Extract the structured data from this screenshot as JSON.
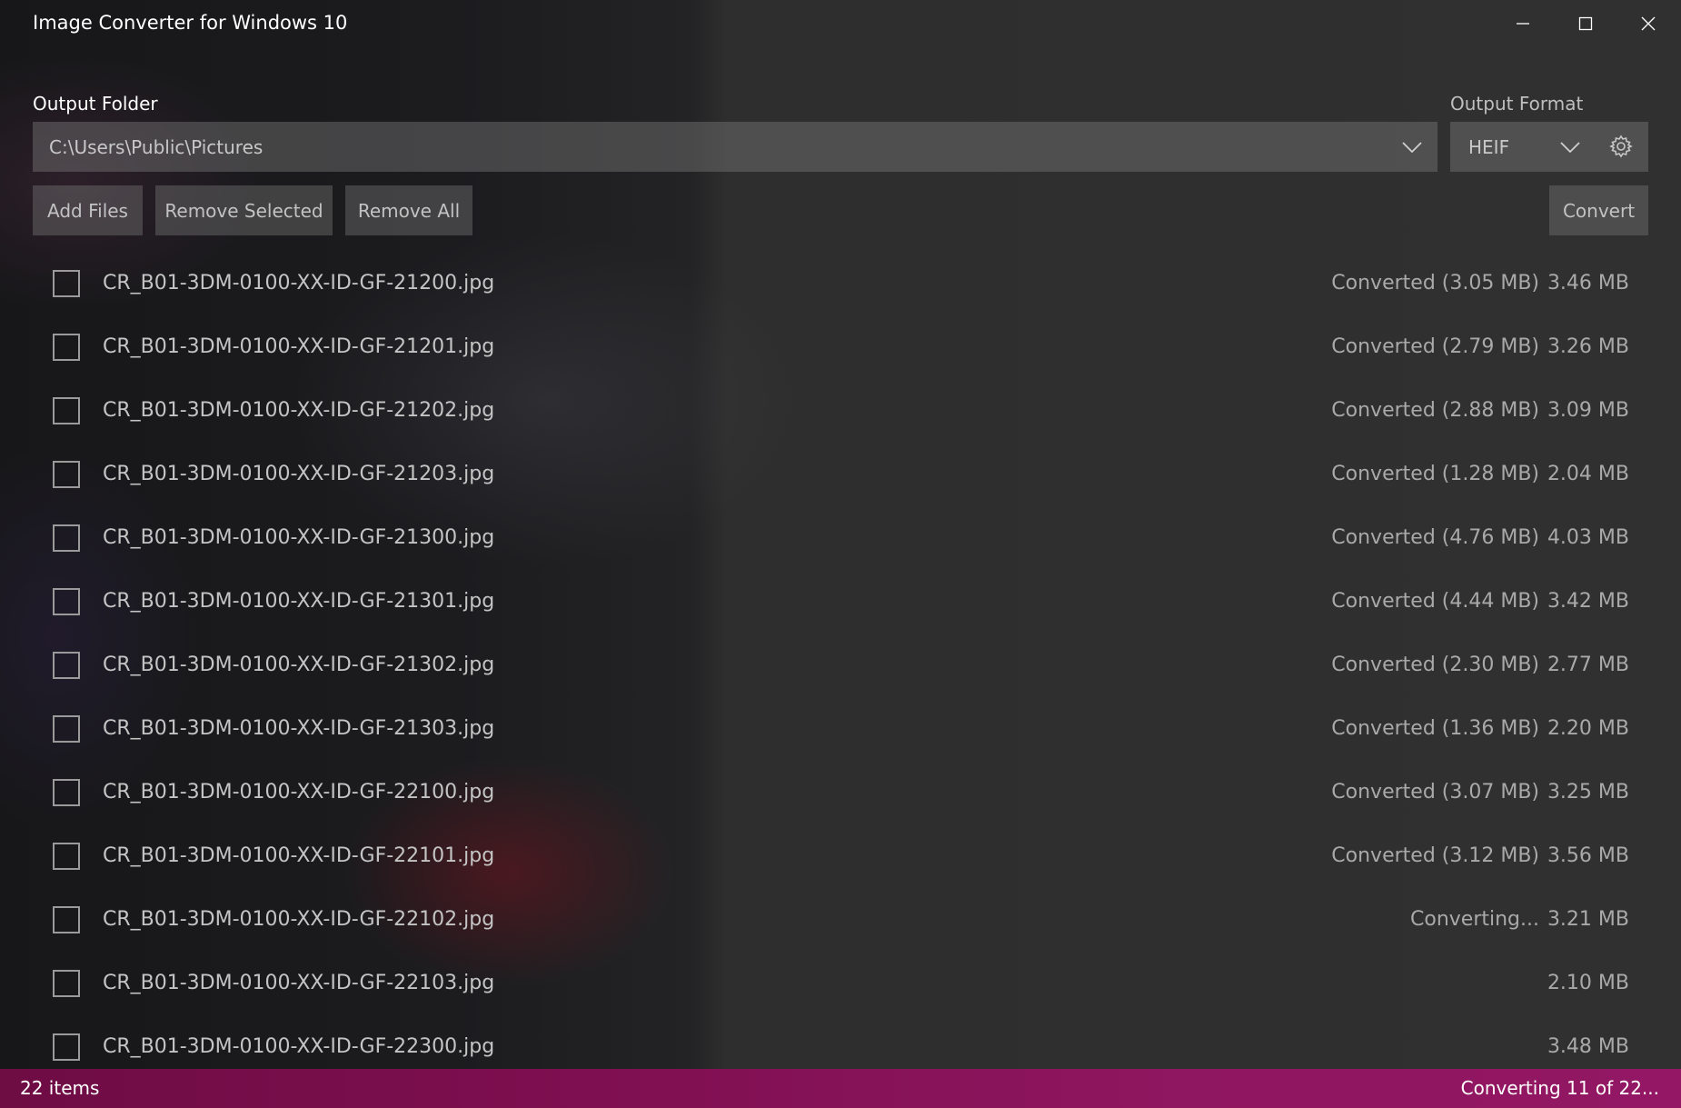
{
  "window": {
    "title": "Image Converter for Windows 10"
  },
  "output_folder": {
    "label": "Output Folder",
    "value": "C:\\Users\\Public\\Pictures"
  },
  "output_format": {
    "label": "Output Format",
    "value": "HEIF"
  },
  "toolbar": {
    "add_files": "Add Files",
    "remove_selected": "Remove Selected",
    "remove_all": "Remove All",
    "convert": "Convert"
  },
  "files": [
    {
      "name": "CR_B01-3DM-0100-XX-ID-GF-21200.jpg",
      "status": "Converted (3.05 MB)",
      "size": "3.46 MB"
    },
    {
      "name": "CR_B01-3DM-0100-XX-ID-GF-21201.jpg",
      "status": "Converted (2.79 MB)",
      "size": "3.26 MB"
    },
    {
      "name": "CR_B01-3DM-0100-XX-ID-GF-21202.jpg",
      "status": "Converted (2.88 MB)",
      "size": "3.09 MB"
    },
    {
      "name": "CR_B01-3DM-0100-XX-ID-GF-21203.jpg",
      "status": "Converted (1.28 MB)",
      "size": "2.04 MB"
    },
    {
      "name": "CR_B01-3DM-0100-XX-ID-GF-21300.jpg",
      "status": "Converted (4.76 MB)",
      "size": "4.03 MB"
    },
    {
      "name": "CR_B01-3DM-0100-XX-ID-GF-21301.jpg",
      "status": "Converted (4.44 MB)",
      "size": "3.42 MB"
    },
    {
      "name": "CR_B01-3DM-0100-XX-ID-GF-21302.jpg",
      "status": "Converted (2.30 MB)",
      "size": "2.77 MB"
    },
    {
      "name": "CR_B01-3DM-0100-XX-ID-GF-21303.jpg",
      "status": "Converted (1.36 MB)",
      "size": "2.20 MB"
    },
    {
      "name": "CR_B01-3DM-0100-XX-ID-GF-22100.jpg",
      "status": "Converted (3.07 MB)",
      "size": "3.25 MB"
    },
    {
      "name": "CR_B01-3DM-0100-XX-ID-GF-22101.jpg",
      "status": "Converted (3.12 MB)",
      "size": "3.56 MB"
    },
    {
      "name": "CR_B01-3DM-0100-XX-ID-GF-22102.jpg",
      "status": "Converting...",
      "size": "3.21 MB"
    },
    {
      "name": "CR_B01-3DM-0100-XX-ID-GF-22103.jpg",
      "status": "",
      "size": "2.10 MB"
    },
    {
      "name": "CR_B01-3DM-0100-XX-ID-GF-22300.jpg",
      "status": "",
      "size": "3.48 MB"
    }
  ],
  "status_bar": {
    "item_count": "22 items",
    "progress": "Converting 11 of 22...",
    "color": "#8a1459"
  },
  "icons": {
    "minimize": "minimize-icon",
    "maximize": "maximize-icon",
    "close": "close-icon",
    "dropdown": "chevron-down-icon",
    "settings": "gear-icon"
  }
}
